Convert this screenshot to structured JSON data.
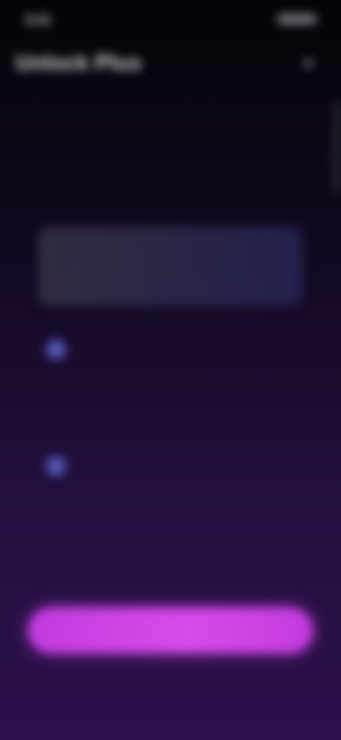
{
  "status_bar": {
    "time": "9:41"
  },
  "header": {
    "title": "Unlock Plus",
    "close_icon": "close-icon",
    "close_glyph": "×"
  },
  "headline": "",
  "price_card": {
    "price": "",
    "subtext": ""
  },
  "features": [
    {
      "icon": "check-icon",
      "glyph": "✓",
      "title": "",
      "description": ""
    },
    {
      "icon": "check-icon",
      "glyph": "✓",
      "title": "",
      "description": ""
    }
  ],
  "note": "",
  "cta": {
    "label": ""
  },
  "fine_print": "",
  "restore_label": "",
  "colors": {
    "accent": "#d146e8",
    "headline_start": "#2bb3a5",
    "headline_mid": "#3a6fd8",
    "headline_end": "#b044d0",
    "feature_icon": "#4a4aa8"
  }
}
